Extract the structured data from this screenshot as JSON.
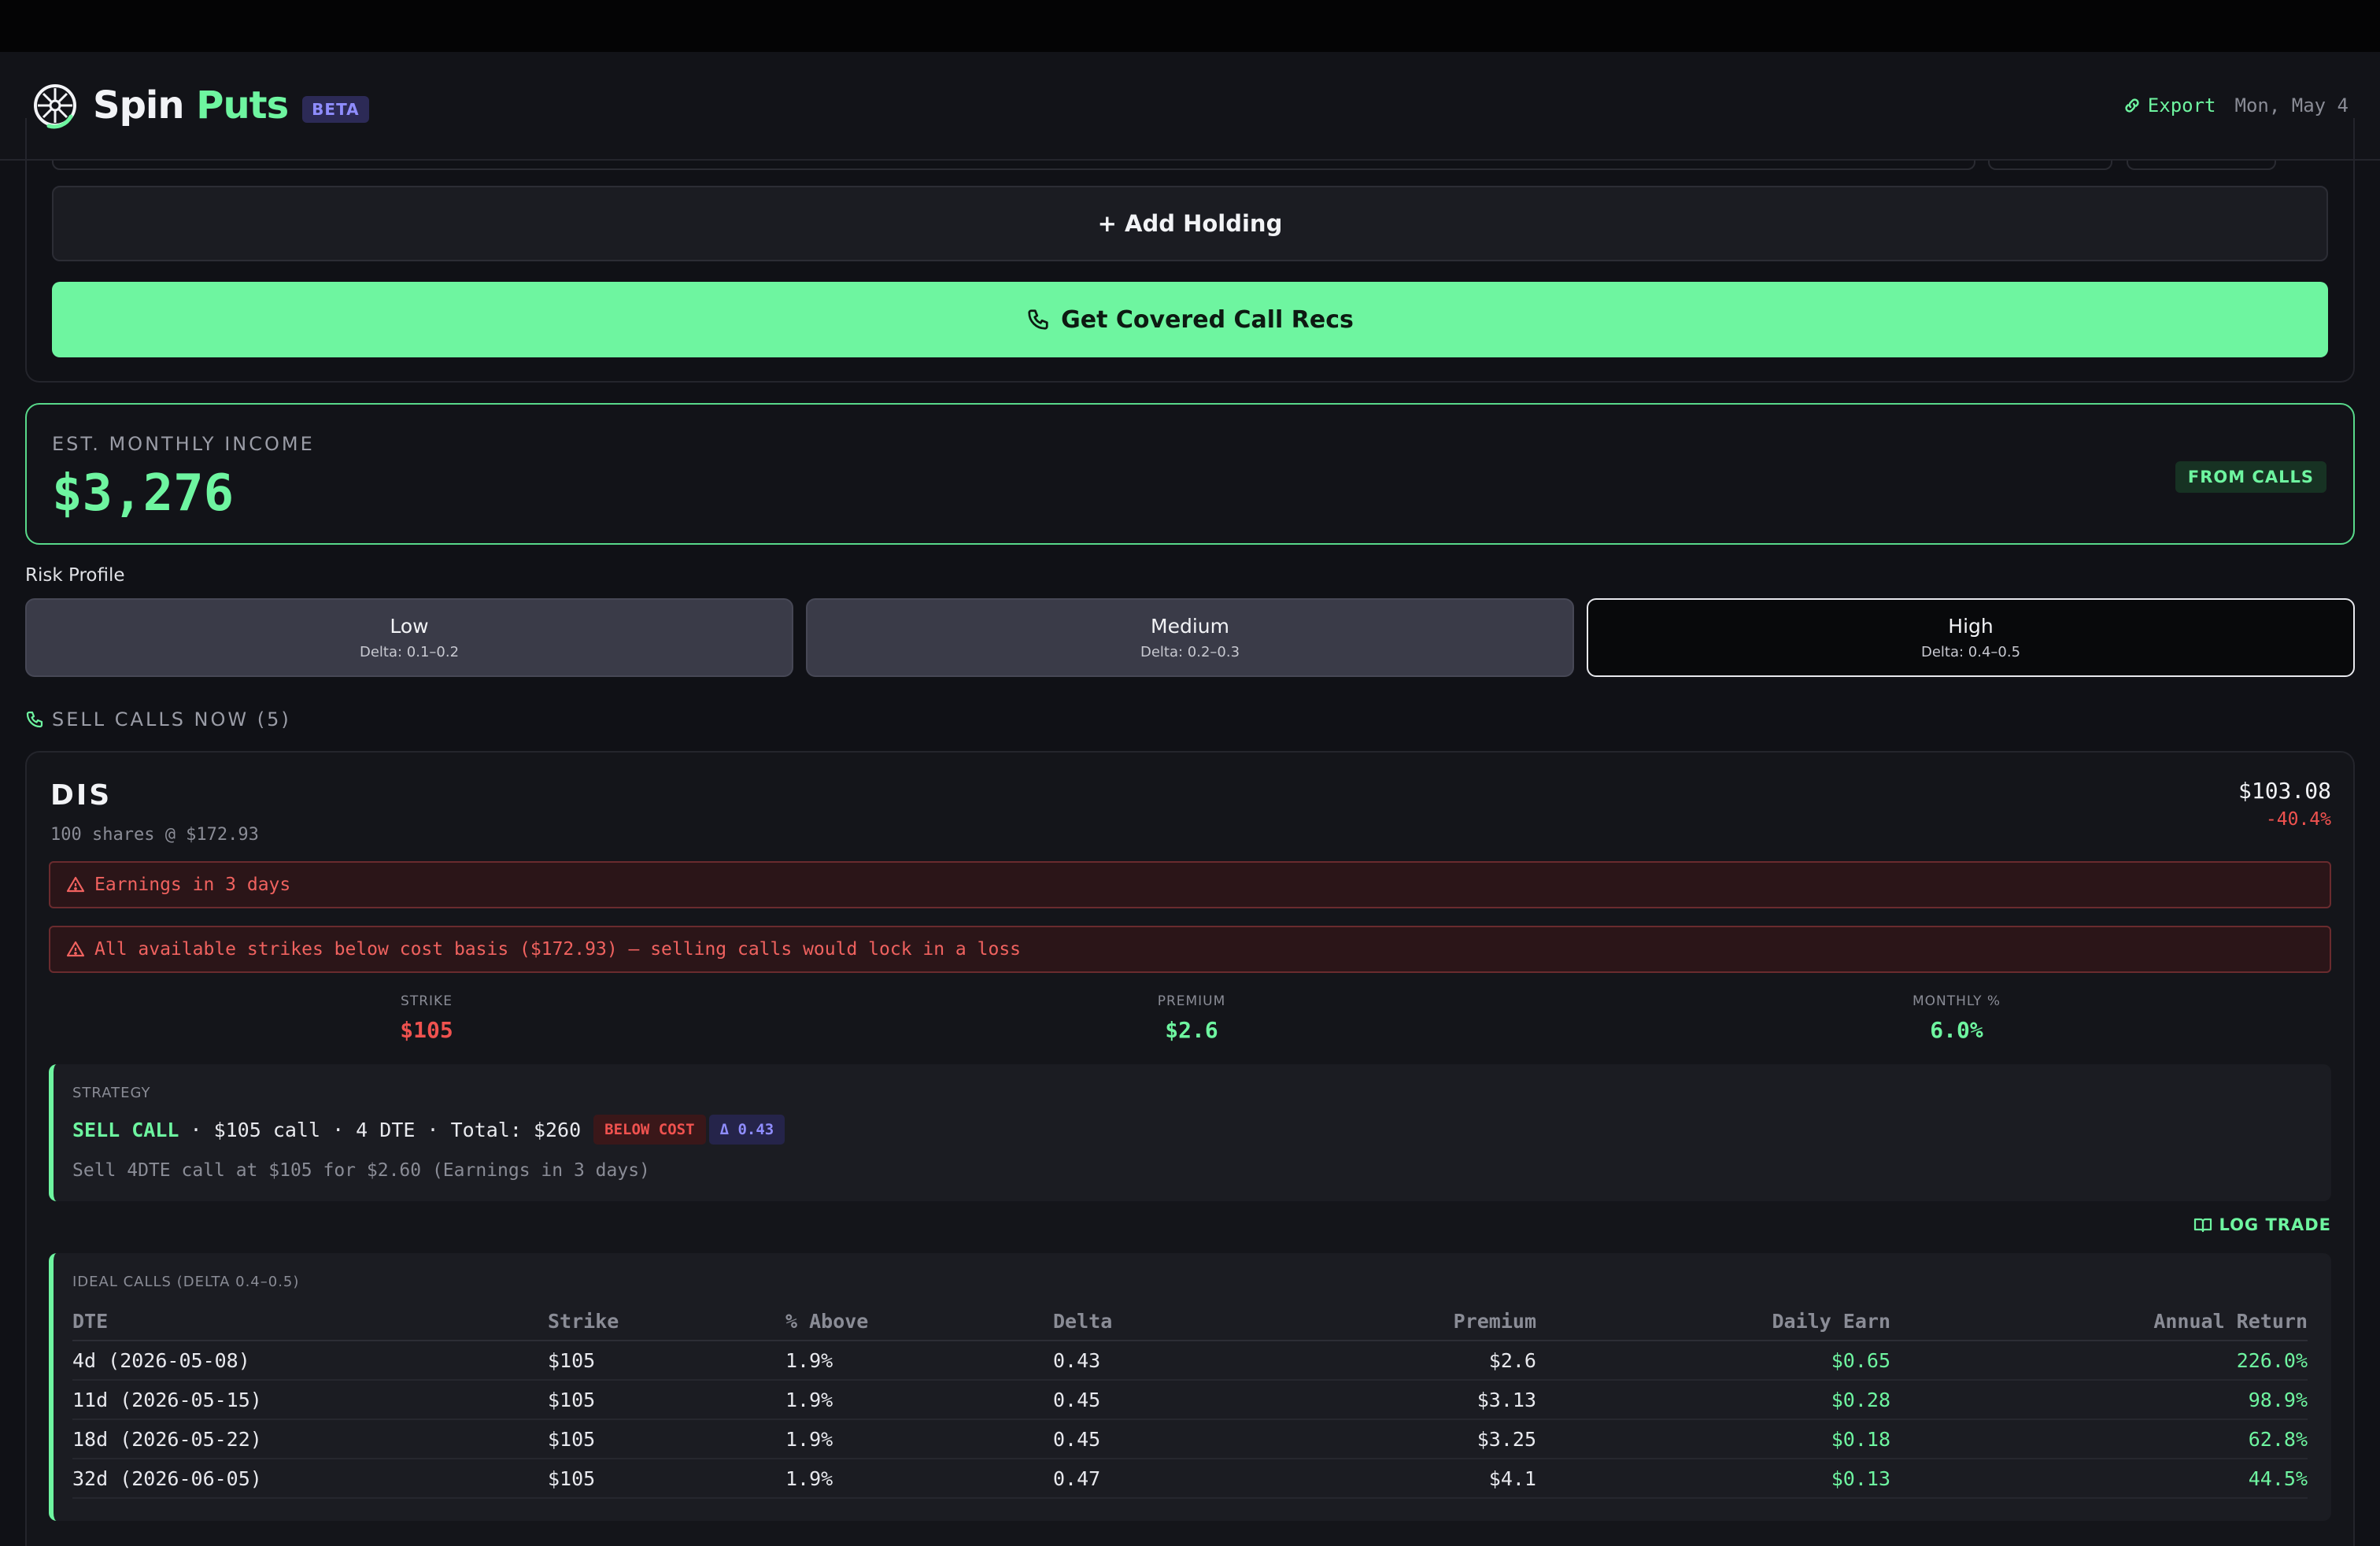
{
  "header": {
    "brand_part1": "Spin",
    "brand_part2": "Puts",
    "beta": "BETA",
    "export_label": "Export",
    "date": "Mon, May 4"
  },
  "holdings": {
    "add_label": "+ Add Holding",
    "recs_label": "Get Covered Call Recs"
  },
  "income": {
    "label": "EST. MONTHLY INCOME",
    "value": "$3,276",
    "badge": "FROM CALLS"
  },
  "risk": {
    "label": "Risk Profile",
    "options": [
      {
        "title": "Low",
        "sub": "Delta: 0.1–0.2"
      },
      {
        "title": "Medium",
        "sub": "Delta: 0.2–0.3"
      },
      {
        "title": "High",
        "sub": "Delta: 0.4–0.5"
      }
    ],
    "selected": "High"
  },
  "sell_calls": {
    "header": "SELL CALLS NOW (5)"
  },
  "stock": {
    "ticker": "DIS",
    "shares": "100 shares @ $172.93",
    "price": "$103.08",
    "change": "-40.4%",
    "warnings": [
      "Earnings in 3 days",
      "All available strikes below cost basis ($172.93) — selling calls would lock in a loss"
    ],
    "metrics": [
      {
        "label": "STRIKE",
        "value": "$105"
      },
      {
        "label": "PREMIUM",
        "value": "$2.6"
      },
      {
        "label": "MONTHLY %",
        "value": "6.0%"
      }
    ],
    "strategy": {
      "label": "STRATEGY",
      "action": "SELL CALL",
      "detail": "· $105 call · 4 DTE · Total: $260",
      "tag_below": "BELOW COST",
      "tag_delta": "Δ 0.43",
      "desc": "Sell 4DTE call at $105 for $2.60 (Earnings in 3 days)"
    },
    "log_trade": "LOG TRADE",
    "ideal": {
      "label": "IDEAL CALLS (DELTA 0.4–0.5)",
      "columns": [
        "DTE",
        "Strike",
        "% Above",
        "Delta",
        "Premium",
        "Daily Earn",
        "Annual Return"
      ],
      "rows": [
        [
          "4d (2026-05-08)",
          "$105",
          "1.9%",
          "0.43",
          "$2.6",
          "$0.65",
          "226.0%"
        ],
        [
          "11d (2026-05-15)",
          "$105",
          "1.9%",
          "0.45",
          "$3.13",
          "$0.28",
          "98.9%"
        ],
        [
          "18d (2026-05-22)",
          "$105",
          "1.9%",
          "0.45",
          "$3.25",
          "$0.18",
          "62.8%"
        ],
        [
          "32d (2026-06-05)",
          "$105",
          "1.9%",
          "0.47",
          "$4.1",
          "$0.13",
          "44.5%"
        ]
      ]
    }
  },
  "colors": {
    "accent": "#6ef5a0",
    "danger": "#f0524f",
    "purple": "#8f8dff",
    "background": "#101116"
  }
}
